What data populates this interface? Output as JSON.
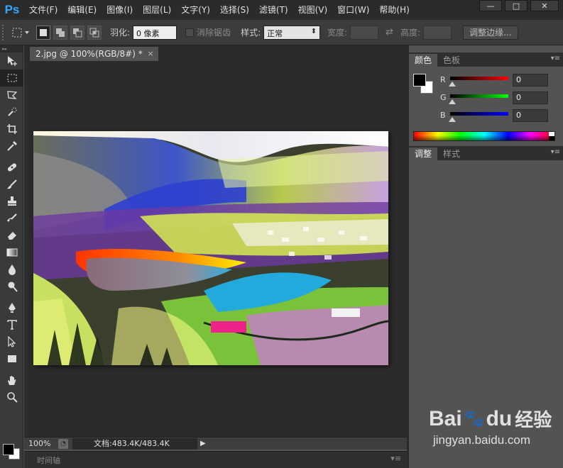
{
  "app": {
    "logo": "Ps"
  },
  "menu": [
    "文件(F)",
    "编辑(E)",
    "图像(I)",
    "图层(L)",
    "文字(Y)",
    "选择(S)",
    "滤镜(T)",
    "视图(V)",
    "窗口(W)",
    "帮助(H)"
  ],
  "window_controls": {
    "minimize": "—",
    "maximize": "□",
    "close": "✕"
  },
  "options": {
    "feather_label": "羽化:",
    "feather_value": "0 像素",
    "antialias_label": "消除锯齿",
    "style_label": "样式:",
    "style_value": "正常",
    "width_label": "宽度:",
    "height_label": "高度:",
    "refine_edge_button": "调整边缘..."
  },
  "document": {
    "tab_title": "2.jpg @ 100%(RGB/8#) *",
    "tab_close": "×",
    "zoom": "100%",
    "doc_info": "文档:483.4K/483.4K"
  },
  "timeline": {
    "label": "时间轴",
    "menu": "▾≡"
  },
  "color_panel": {
    "tabs": [
      "颜色",
      "色板"
    ],
    "channels": [
      {
        "label": "R",
        "value": "0",
        "gradient": "linear-gradient(to right,#000,#ff0000)"
      },
      {
        "label": "G",
        "value": "0",
        "gradient": "linear-gradient(to right,#000,#00ff00)"
      },
      {
        "label": "B",
        "value": "0",
        "gradient": "linear-gradient(to right,#000,#0000ff)"
      }
    ],
    "foreground": "#000000",
    "background": "#ffffff"
  },
  "adjust_panel": {
    "tabs": [
      "调整",
      "样式"
    ]
  },
  "panel_menu": "▾≡",
  "watermark": {
    "brand_left": "Bai",
    "brand_right": "du",
    "brand_cn": "经验",
    "url": "jingyan.baidu.com"
  }
}
